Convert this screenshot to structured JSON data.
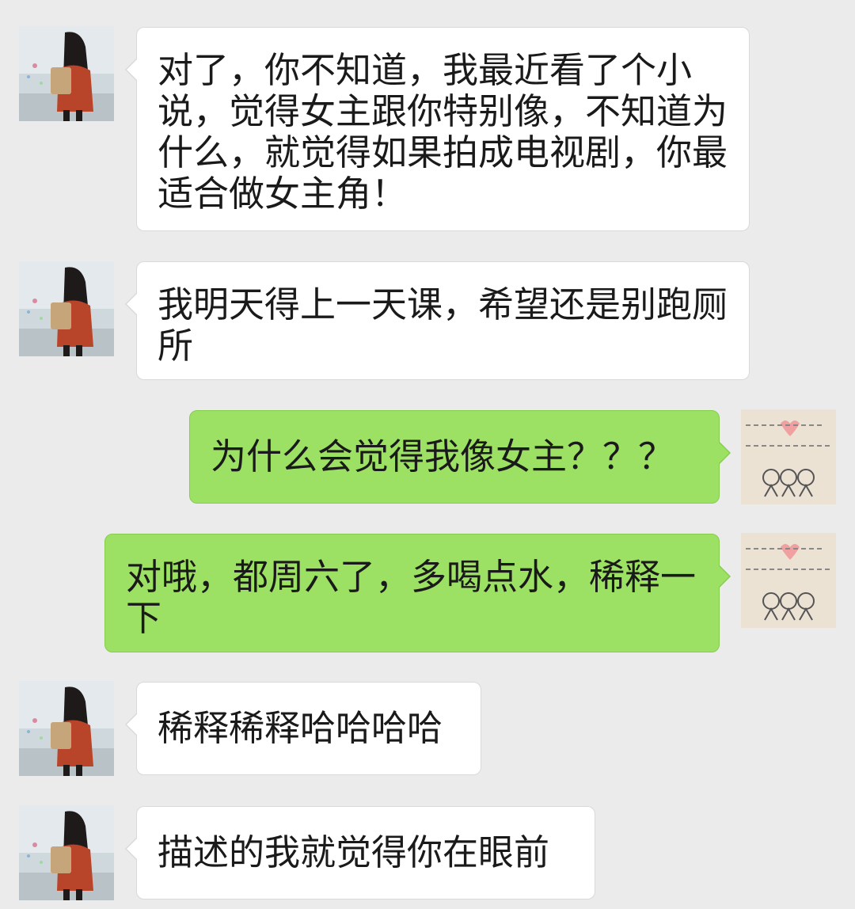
{
  "colors": {
    "background": "#ebebeb",
    "received_bubble": "#ffffff",
    "sent_bubble": "#9ce163"
  },
  "messages": [
    {
      "side": "left",
      "avatar_icon": "girl-backpack-avatar-icon",
      "text": "对了，你不知道，我最近看了个小说，觉得女主跟你特别像，不知道为什么，就觉得如果拍成电视剧，你最适合做女主角！"
    },
    {
      "side": "left",
      "avatar_icon": "girl-backpack-avatar-icon",
      "text": "我明天得上一天课，希望还是别跑厕所"
    },
    {
      "side": "right",
      "avatar_icon": "doodle-friends-avatar-icon",
      "text": "为什么会觉得我像女主？？？"
    },
    {
      "side": "right",
      "avatar_icon": "doodle-friends-avatar-icon",
      "text": "对哦，都周六了，多喝点水，稀释一下"
    },
    {
      "side": "left",
      "avatar_icon": "girl-backpack-avatar-icon",
      "text": "稀释稀释哈哈哈哈"
    },
    {
      "side": "left",
      "avatar_icon": "girl-backpack-avatar-icon",
      "text": "描述的我就觉得你在眼前"
    }
  ]
}
